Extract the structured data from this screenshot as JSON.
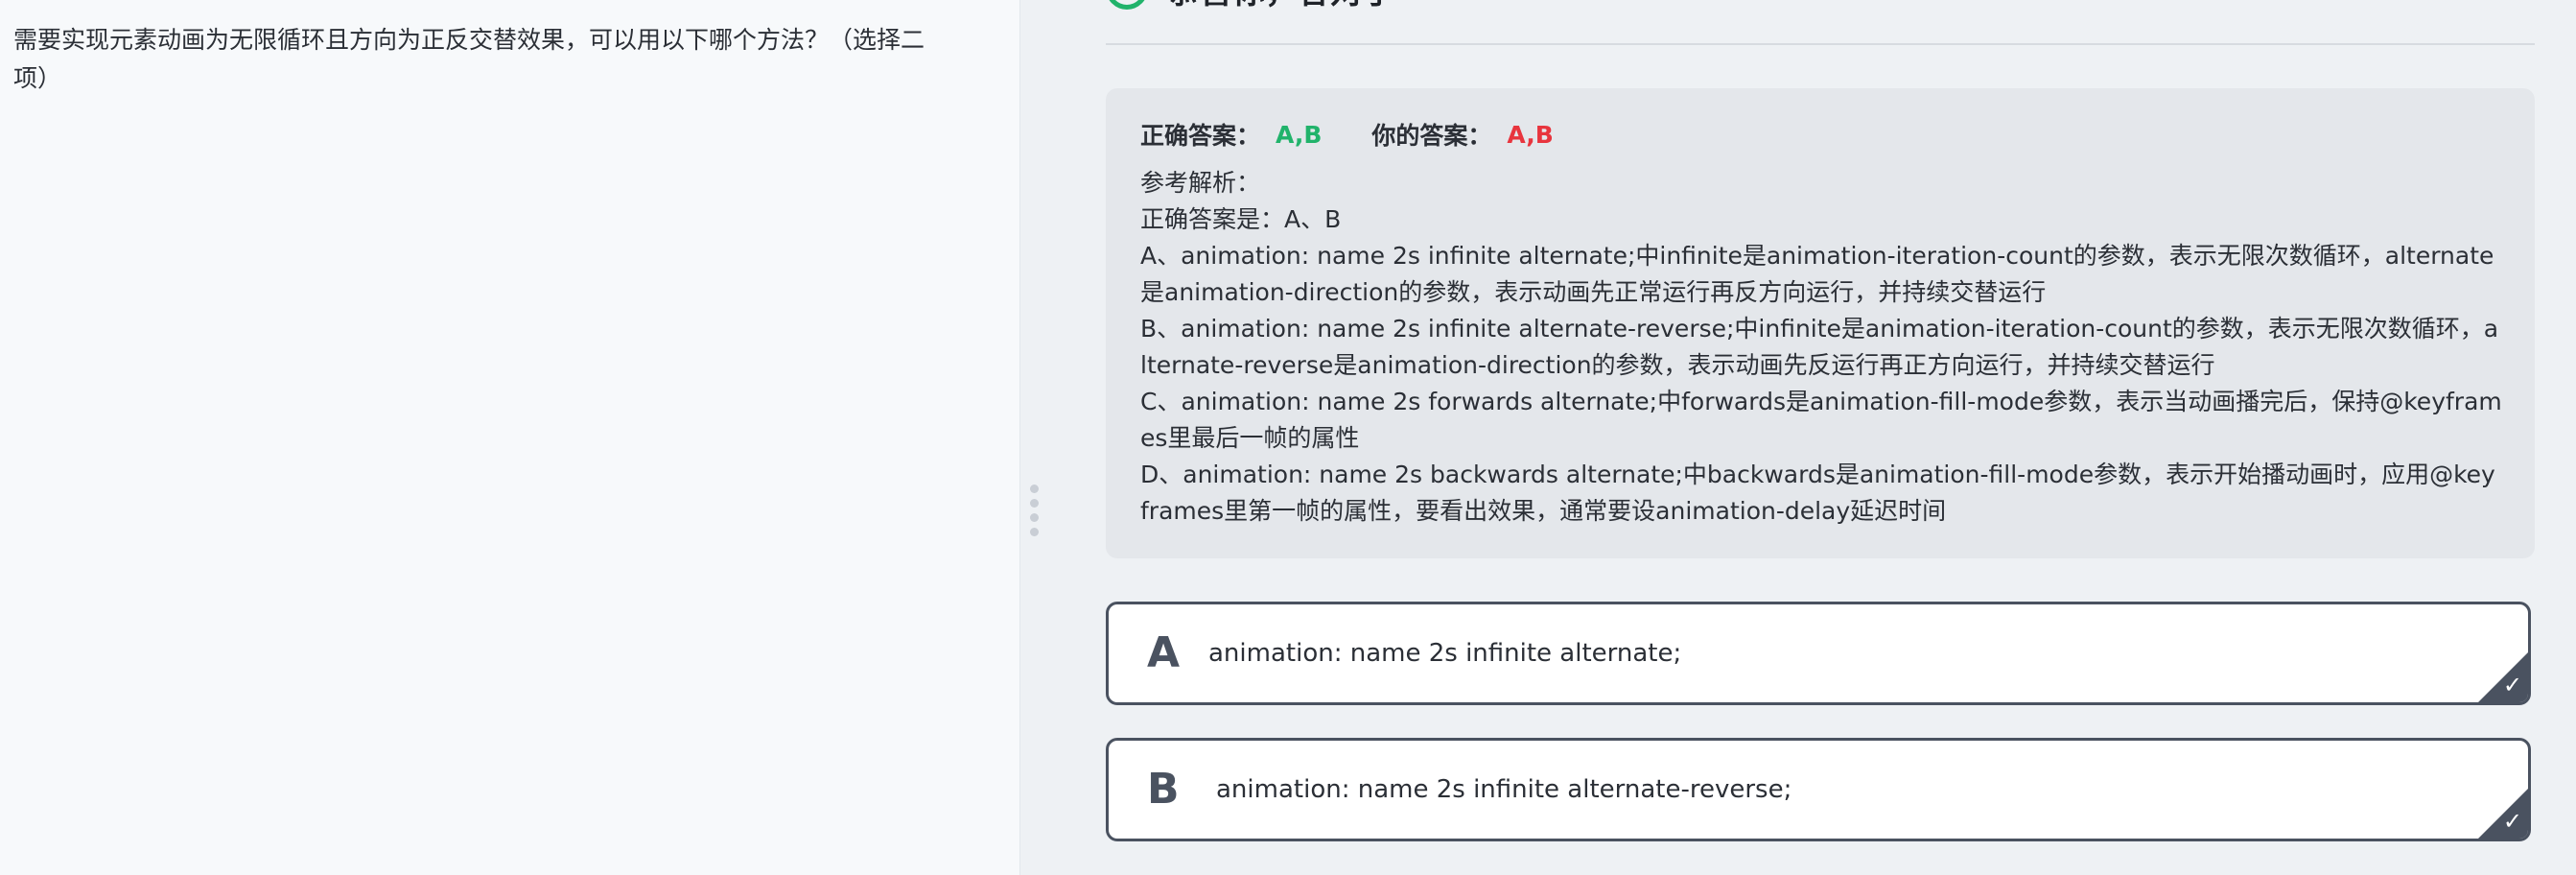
{
  "question": {
    "text": "需要实现元素动画为无限循环且方向为正反交替效果，可以用以下哪个方法？（选择二项）"
  },
  "colors": {
    "correct": "#21b36b",
    "wrong": "#e8353e",
    "option_border": "#4a5260"
  },
  "result": {
    "status_label": "恭喜你，答对了",
    "status_icon": "check-circle-icon"
  },
  "analysis": {
    "correct_answer_label": "正确答案：",
    "correct_answer": "A,B",
    "your_answer_label": "你的答案：",
    "your_answer": "A,B",
    "reference_label": "参考解析：",
    "lines": [
      "正确答案是：A、B",
      "A、animation: name 2s infinite alternate;中infinite是animation-iteration-count的参数，表示无限次数循环，alternate是animation-direction的参数，表示动画先正常运行再反方向运行，并持续交替运行",
      "B、animation: name 2s infinite alternate-reverse;中infinite是animation-iteration-count的参数，表示无限次数循环，alternate-reverse是animation-direction的参数，表示动画先反运行再正方向运行，并持续交替运行",
      "C、animation: name 2s forwards alternate;中forwards是animation-fill-mode参数，表示当动画播完后，保持@keyframes里最后一帧的属性",
      "D、animation: name 2s backwards alternate;中backwards是animation-fill-mode参数，表示开始播动画时，应用@keyframes里第一帧的属性，要看出效果，通常要设animation-delay延迟时间"
    ]
  },
  "options": [
    {
      "letter": "A",
      "text": "animation: name 2s infinite alternate;",
      "selected": true,
      "check_icon": "check-icon"
    },
    {
      "letter": "B",
      "text": "animation: name 2s infinite alternate-reverse;",
      "selected": true,
      "check_icon": "check-icon"
    }
  ]
}
